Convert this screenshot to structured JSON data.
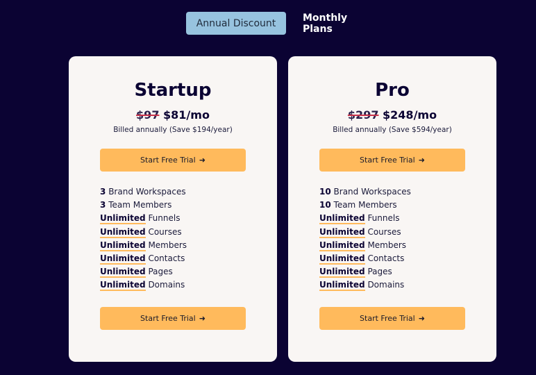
{
  "billing_toggle": {
    "options": [
      {
        "label": "Annual Discount",
        "active": true
      },
      {
        "label": "Monthly Plans",
        "active": false
      }
    ]
  },
  "plans": [
    {
      "name": "Startup",
      "old_price": "$97",
      "new_price": "$81/mo",
      "billing_note": "Billed annually (Save $194/year)",
      "cta_label": "Start Free Trial",
      "cta_icon": "arrow-right-icon",
      "features": [
        {
          "qty": "3",
          "label": "Brand Workspaces",
          "underline": false
        },
        {
          "qty": "3",
          "label": "Team Members",
          "underline": false
        },
        {
          "qty": "Unlimited",
          "label": "Funnels",
          "underline": true
        },
        {
          "qty": "Unlimited",
          "label": "Courses",
          "underline": true
        },
        {
          "qty": "Unlimited",
          "label": "Members",
          "underline": true
        },
        {
          "qty": "Unlimited",
          "label": "Contacts",
          "underline": true
        },
        {
          "qty": "Unlimited",
          "label": "Pages",
          "underline": true
        },
        {
          "qty": "Unlimited",
          "label": "Domains",
          "underline": true
        }
      ]
    },
    {
      "name": "Pro",
      "old_price": "$297",
      "new_price": "$248/mo",
      "billing_note": "Billed annually (Save $594/year)",
      "cta_label": "Start Free Trial",
      "cta_icon": "arrow-right-icon",
      "features": [
        {
          "qty": "10",
          "label": "Brand Workspaces",
          "underline": false
        },
        {
          "qty": "10",
          "label": "Team Members",
          "underline": false
        },
        {
          "qty": "Unlimited",
          "label": "Funnels",
          "underline": true
        },
        {
          "qty": "Unlimited",
          "label": "Courses",
          "underline": true
        },
        {
          "qty": "Unlimited",
          "label": "Members",
          "underline": true
        },
        {
          "qty": "Unlimited",
          "label": "Contacts",
          "underline": true
        },
        {
          "qty": "Unlimited",
          "label": "Pages",
          "underline": true
        },
        {
          "qty": "Unlimited",
          "label": "Domains",
          "underline": true
        }
      ]
    }
  ],
  "colors": {
    "background": "#0b0333",
    "card": "#f9f6f4",
    "accent": "#ffba5c",
    "toggle_active": "#97c3df",
    "strike": "#c8324a"
  }
}
